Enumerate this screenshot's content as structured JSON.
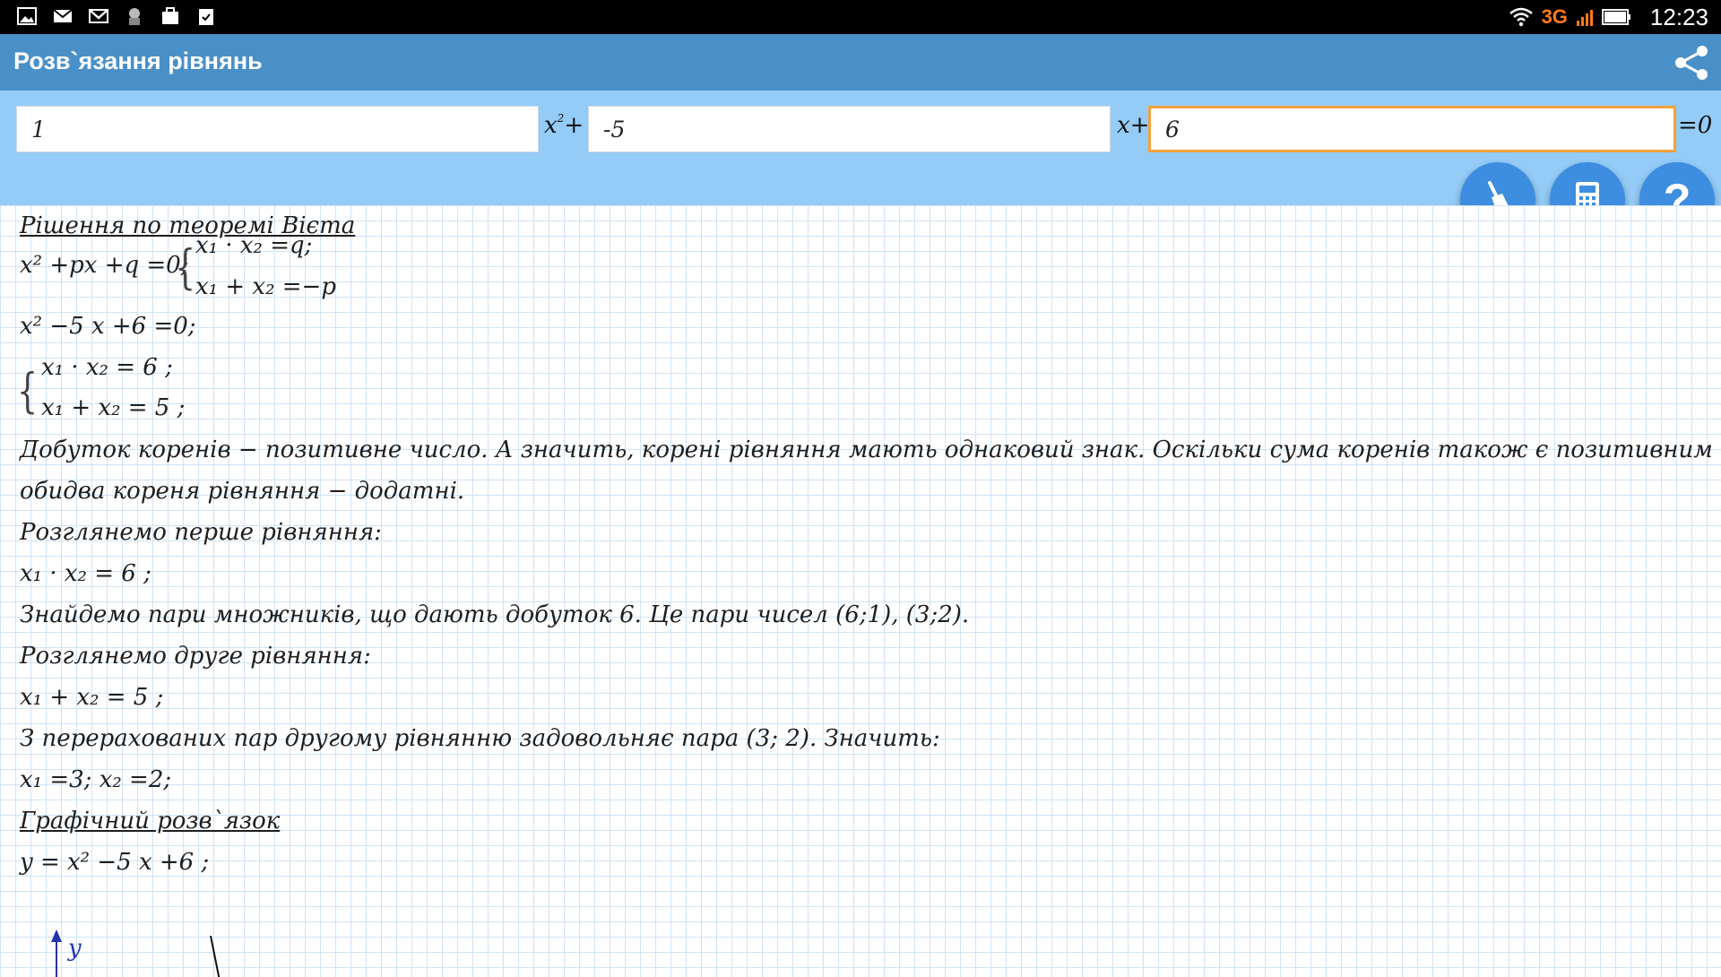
{
  "status_bar": {
    "network": "3G",
    "time": "12:23"
  },
  "app_bar": {
    "title": "Розв`язання рівнянь"
  },
  "equation_input": {
    "a": "1",
    "b": "-5",
    "c": "6",
    "x2_term": "x",
    "x2_exp": "2",
    "plus1": "+",
    "x_term": "x+",
    "equals": "=0"
  },
  "actions": {
    "help_label": "?"
  },
  "solution": {
    "vieta_heading": "Рішення по теоремі Вієта",
    "general_eq": "x² +px +q =0;",
    "general_sys_1": "x₁ · x₂ =q;",
    "general_sys_2": "x₁ + x₂ =−p",
    "specific_eq": "x² −5 x +6 =0;",
    "specific_sys_1": "x₁ · x₂ = 6 ;",
    "specific_sys_2": "x₁ + x₂ = 5 ;",
    "text_1": "Добуток коренів − позитивне число. А значить, корені рівняння мають однаковий знак. Оскільки сума коренів також є позитивним числом,",
    "text_2": "обидва кореня рівняння − додатні.",
    "text_3": "Розглянемо перше рівняння:",
    "eq_product": "x₁ · x₂ = 6 ;",
    "text_4": "Знайдемо пари множників, що дають добуток 6. Це пари чисел (6;1), (3;2).",
    "text_5": "Розглянемо друге рівняння:",
    "eq_sum": "x₁ + x₂ = 5 ;",
    "text_6": "З перерахованих пар другому рівнянню задовольняє пара (3; 2). Значить:",
    "roots": "x₁ =3; x₂ =2;",
    "graph_heading": "Графічний розв`язок",
    "graph_eq": "y = x² −5 x +6 ;",
    "graph_axis_label": "y"
  }
}
